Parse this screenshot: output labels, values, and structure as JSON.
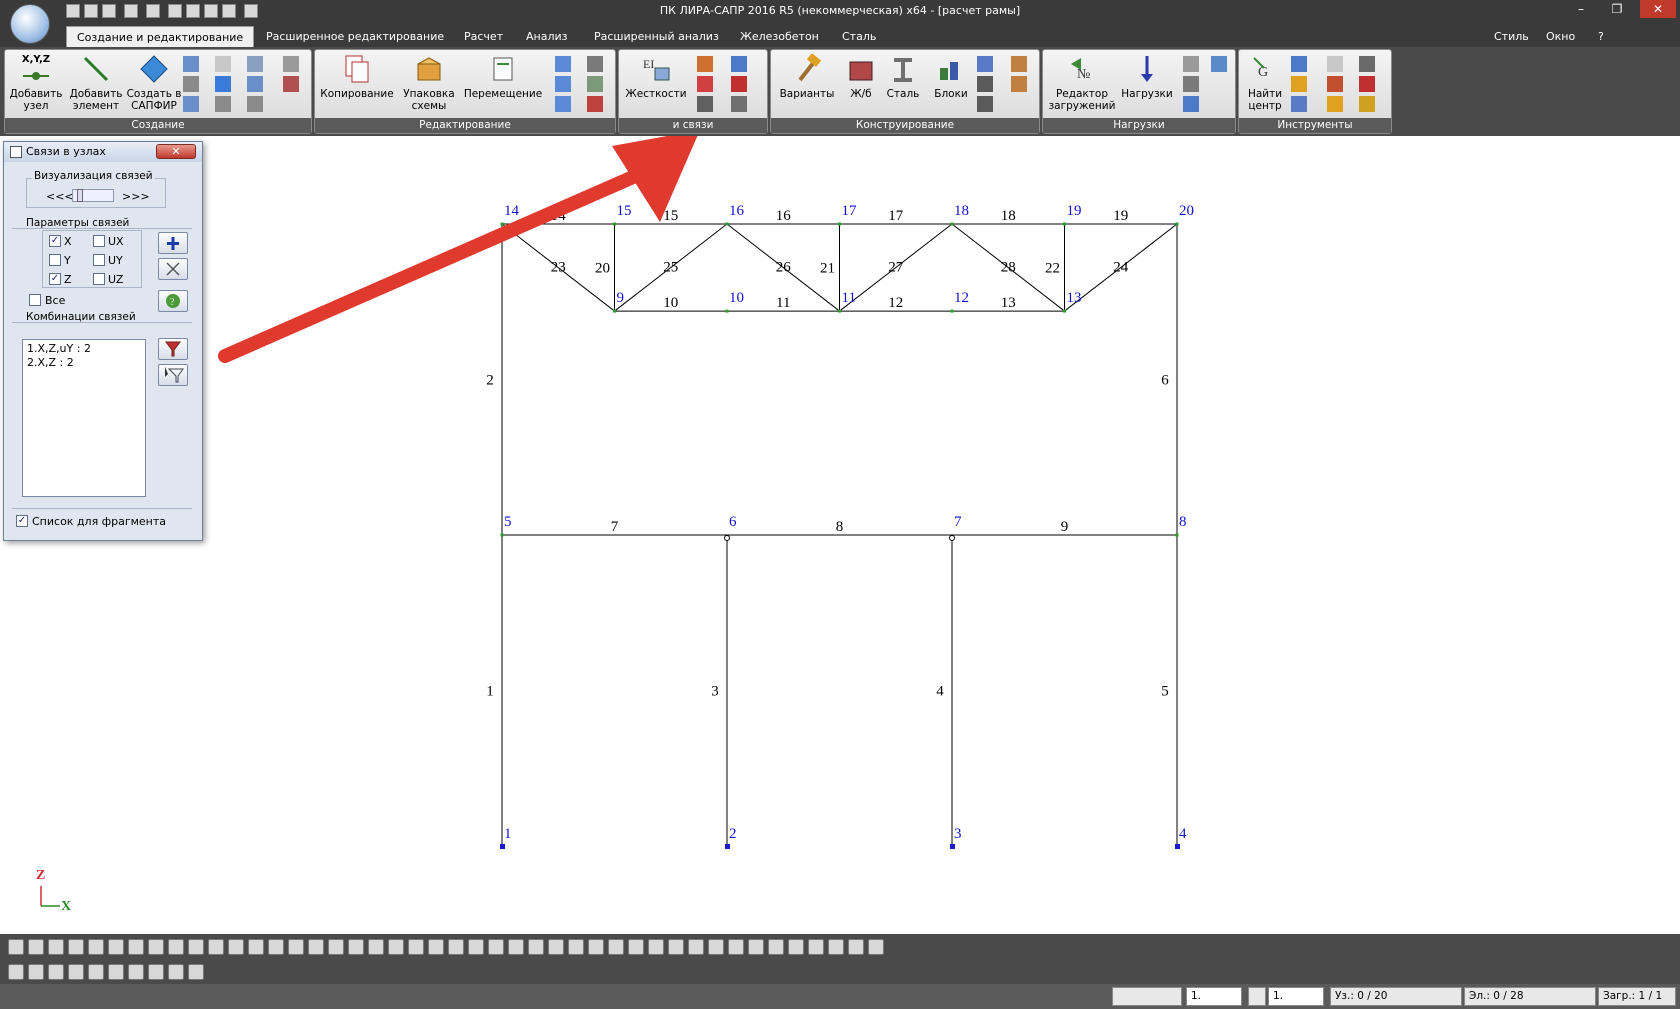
{
  "window": {
    "title": "ПК ЛИРА-САПР  2016 R5 (некоммерческая) x64 - [расчет рамы]",
    "controls": [
      "–",
      "❐",
      "✕"
    ]
  },
  "tabs": [
    "Создание и редактирование",
    "Расширенное редактирование",
    "Расчет",
    "Анализ",
    "Расширенный анализ",
    "Железобетон",
    "Сталь"
  ],
  "right_menu": {
    "style": "Стиль",
    "window": "Окно",
    "help": "?"
  },
  "ribbon": {
    "groups": {
      "create": "Создание",
      "edit": "Редактирование",
      "links": "и связи",
      "construct": "Конструирование",
      "loads": "Нагрузки",
      "tools": "Инструменты"
    },
    "buttons": {
      "add_node_1": "Добавить",
      "add_node_2": "узел",
      "add_elem_1": "Добавить",
      "add_elem_2": "элемент",
      "sapfir_1": "Создать в",
      "sapfir_2": "САПФИР",
      "copy": "Копирование",
      "pack_1": "Упаковка",
      "pack_2": "схемы",
      "move": "Перемещение",
      "stiff": "Жесткости",
      "variants": "Варианты",
      "rc": "Ж/б",
      "steel": "Сталь",
      "blocks": "Блоки",
      "load_editor_1": "Редактор",
      "load_editor_2": "загружений",
      "loads": "Нагрузки",
      "find_center_1": "Найти",
      "find_center_2": "центр",
      "xyz": "X,Y,Z"
    }
  },
  "dialog": {
    "title": "Связи в узлах",
    "close": "✕",
    "visualization": {
      "label": "Визуализация связей",
      "left": "<<<",
      "right": ">>>"
    },
    "params": {
      "label": "Параметры связей",
      "items": [
        {
          "label": "X",
          "checked": true
        },
        {
          "label": "UX",
          "checked": false
        },
        {
          "label": "Y",
          "checked": false
        },
        {
          "label": "UY",
          "checked": false
        },
        {
          "label": "Z",
          "checked": true
        },
        {
          "label": "UZ",
          "checked": false
        }
      ],
      "all": "Все"
    },
    "combos": {
      "label": "Комбинации связей",
      "items": [
        "1.X,Z,uY  :  2",
        "2.X,Z  :  2"
      ]
    },
    "fragment": "Список для фрагмента"
  },
  "axes": {
    "z": "Z",
    "x": "X"
  },
  "model": {
    "nodes": [
      {
        "id": "1",
        "x": 0,
        "z": 0
      },
      {
        "id": "2",
        "x": 1,
        "z": 0
      },
      {
        "id": "3",
        "x": 2,
        "z": 0
      },
      {
        "id": "4",
        "x": 3,
        "z": 0
      },
      {
        "id": "5",
        "x": 0,
        "z": 1
      },
      {
        "id": "6",
        "x": 1,
        "z": 1
      },
      {
        "id": "7",
        "x": 2,
        "z": 1
      },
      {
        "id": "8",
        "x": 3,
        "z": 1
      },
      {
        "id": "9",
        "x": 0.5,
        "z": 1.72
      },
      {
        "id": "10",
        "x": 1,
        "z": 1.72
      },
      {
        "id": "11",
        "x": 1.5,
        "z": 1.72
      },
      {
        "id": "12",
        "x": 2,
        "z": 1.72
      },
      {
        "id": "13",
        "x": 2.5,
        "z": 1.72
      },
      {
        "id": "14",
        "x": 0,
        "z": 2
      },
      {
        "id": "15",
        "x": 0.5,
        "z": 2
      },
      {
        "id": "16",
        "x": 1,
        "z": 2
      },
      {
        "id": "17",
        "x": 1.5,
        "z": 2
      },
      {
        "id": "18",
        "x": 2,
        "z": 2
      },
      {
        "id": "19",
        "x": 2.5,
        "z": 2
      },
      {
        "id": "20",
        "x": 3,
        "z": 2
      }
    ],
    "elements": [
      {
        "id": "1",
        "a": "1",
        "b": "5"
      },
      {
        "id": "2",
        "a": "5",
        "b": "14"
      },
      {
        "id": "3",
        "a": "2",
        "b": "6"
      },
      {
        "id": "4",
        "a": "3",
        "b": "7"
      },
      {
        "id": "5",
        "a": "4",
        "b": "8"
      },
      {
        "id": "6",
        "a": "8",
        "b": "20"
      },
      {
        "id": "7",
        "a": "5",
        "b": "6"
      },
      {
        "id": "8",
        "a": "6",
        "b": "7"
      },
      {
        "id": "9",
        "a": "7",
        "b": "8"
      },
      {
        "id": "10",
        "a": "9",
        "b": "10"
      },
      {
        "id": "11",
        "a": "10",
        "b": "11"
      },
      {
        "id": "12",
        "a": "11",
        "b": "12"
      },
      {
        "id": "13",
        "a": "12",
        "b": "13"
      },
      {
        "id": "14",
        "a": "14",
        "b": "15"
      },
      {
        "id": "15",
        "a": "15",
        "b": "16"
      },
      {
        "id": "16",
        "a": "16",
        "b": "17"
      },
      {
        "id": "17",
        "a": "17",
        "b": "18"
      },
      {
        "id": "18",
        "a": "18",
        "b": "19"
      },
      {
        "id": "19",
        "a": "19",
        "b": "20"
      },
      {
        "id": "20",
        "a": "15",
        "b": "9"
      },
      {
        "id": "21",
        "a": "17",
        "b": "11"
      },
      {
        "id": "22",
        "a": "19",
        "b": "13"
      },
      {
        "id": "23",
        "a": "14",
        "b": "9"
      },
      {
        "id": "24",
        "a": "13",
        "b": "20"
      },
      {
        "id": "25",
        "a": "9",
        "b": "16"
      },
      {
        "id": "26",
        "a": "16",
        "b": "11"
      },
      {
        "id": "27",
        "a": "11",
        "b": "18"
      },
      {
        "id": "28",
        "a": "18",
        "b": "13"
      }
    ]
  },
  "statusbar": {
    "combo1": "1.",
    "combo2": "1.",
    "nodes": "Уз.: 0 / 20",
    "elements": "Эл.: 0 / 28",
    "loads": "Загр.: 1 / 1"
  },
  "colors": {
    "node_label": "#1010d0",
    "element_label": "#000000",
    "arrow": "#e03a2f",
    "chrome": "#3a3a3a"
  }
}
